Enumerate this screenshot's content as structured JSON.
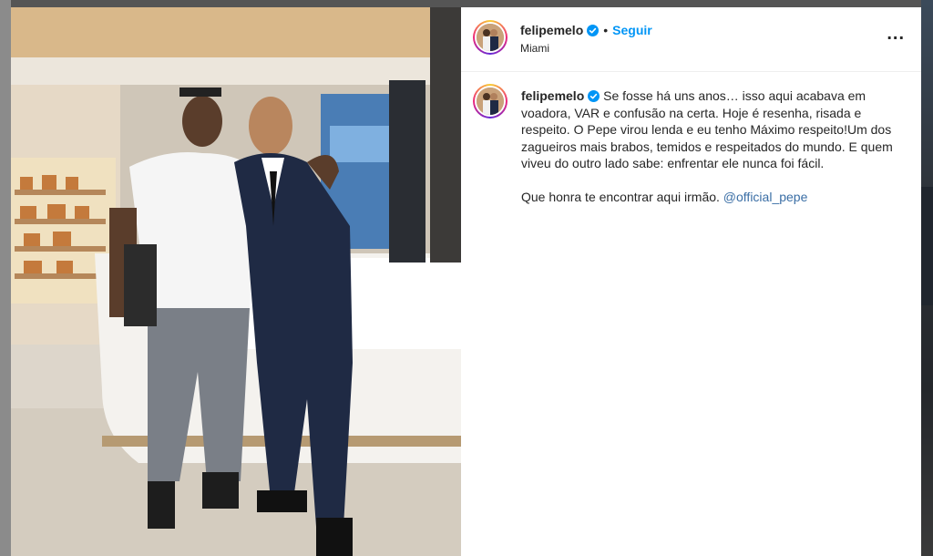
{
  "post": {
    "username": "felipemelo",
    "verified": true,
    "separator": "•",
    "follow_label": "Seguir",
    "location": "Miami",
    "more_label": "...",
    "caption": {
      "paragraph1": "Se fosse há uns anos… isso aqui acabava em voadora, VAR e confusão na certa. Hoje é resenha, risada e respeito. O Pepe virou lenda e eu tenho Máximo respeito!Um dos zagueiros mais brabos, temidos e respeitados do mundo. E quem viveu do outro lado sabe: enfrentar ele nunca foi fácil.",
      "paragraph2_text": "Que honra te encontrar aqui irmão. ",
      "mention": "@official_pepe"
    }
  },
  "colors": {
    "accent": "#0095f6",
    "verified_badge": "#0095f6",
    "text": "#262626"
  },
  "icons": {
    "verified": "verified-badge-icon",
    "more": "more-options-icon"
  }
}
